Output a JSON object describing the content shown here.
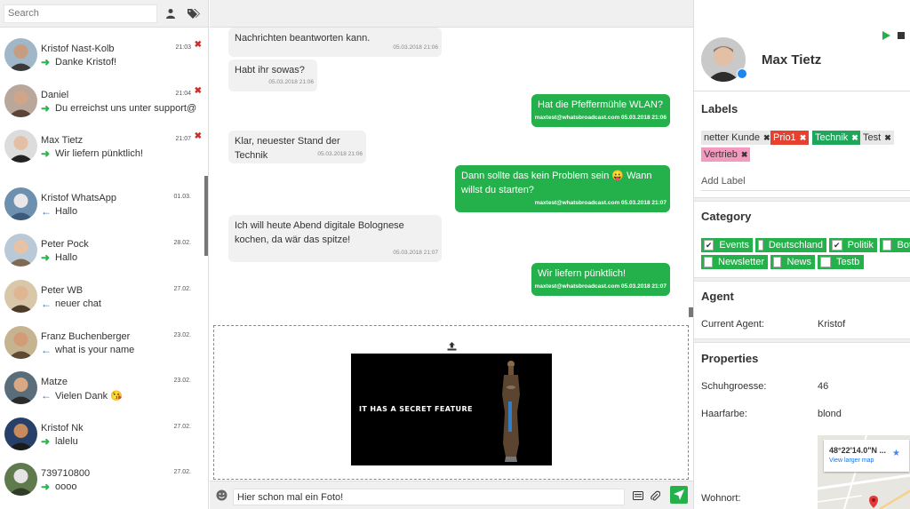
{
  "search": {
    "placeholder": "Search"
  },
  "contacts": [
    {
      "name": "Kristof Nast-Kolb",
      "time": "21:03",
      "last": "Danke Kristof!",
      "dir": "out",
      "closable": true
    },
    {
      "name": "Daniel",
      "time": "21:04",
      "last": "Du erreichst uns unter support@...",
      "dir": "out",
      "closable": true
    },
    {
      "name": "Max Tietz",
      "time": "21:07",
      "last": "Wir liefern pünktlich!",
      "dir": "out",
      "closable": true
    },
    {
      "name": "Kristof WhatsApp",
      "time": "01.03.",
      "last": "Hallo",
      "dir": "in",
      "closable": false
    },
    {
      "name": "Peter Pock",
      "time": "28.02.",
      "last": "Hallo",
      "dir": "out",
      "closable": false
    },
    {
      "name": "Peter WB",
      "time": "27.02.",
      "last": "neuer chat",
      "dir": "in",
      "closable": false
    },
    {
      "name": "Franz Buchenberger",
      "time": "23.02.",
      "last": "what is your name",
      "dir": "in",
      "closable": false
    },
    {
      "name": "Matze",
      "time": "23.02.",
      "last": "Vielen Dank 😘",
      "dir": "in",
      "closable": false
    },
    {
      "name": "Kristof Nk",
      "time": "27.02.",
      "last": "lalelu",
      "dir": "out",
      "closable": false
    },
    {
      "name": "739710800",
      "time": "27.02.",
      "last": "oooo",
      "dir": "out",
      "closable": false
    }
  ],
  "messages": [
    {
      "dir": "in",
      "text": "Nachrichten beantworten kann.",
      "meta": "05.03.2018 21:06"
    },
    {
      "dir": "in",
      "text": "Habt ihr sowas?",
      "meta": "05.03.2018 21:06"
    },
    {
      "dir": "out",
      "text": "Hat die Pfeffermühle WLAN?",
      "meta": "maxtest@whatsbroadcast.com 05.03.2018 21:06"
    },
    {
      "dir": "in",
      "text": "Klar, neuester Stand der Technik",
      "meta": "05.03.2018 21:06"
    },
    {
      "dir": "out",
      "text": "Dann sollte das kein Problem sein 😛 Wann willst du starten?",
      "meta": "maxtest@whatsbroadcast.com 05.03.2018 21:07"
    },
    {
      "dir": "in",
      "text": "Ich will heute Abend digitale Bolognese kochen, da wär das spitze!",
      "meta": "05.03.2018 21:07"
    },
    {
      "dir": "out",
      "text": "Wir liefern pünktlich!",
      "meta": "maxtest@whatsbroadcast.com 05.03.2018 21:07"
    }
  ],
  "upload": {
    "preview_text": "IT HAS A SECRET FEATURE"
  },
  "composer": {
    "value": "Hier schon mal ein Foto!"
  },
  "profile": {
    "name": "Max Tietz"
  },
  "labels": {
    "title": "Labels",
    "items": [
      {
        "text": "netter Kunde",
        "bg": "#e8e8e8",
        "fg": "#333333"
      },
      {
        "text": "Prio1",
        "bg": "#e8402e",
        "fg": "#ffffff"
      },
      {
        "text": "Technik",
        "bg": "#1ea65a",
        "fg": "#ffffff"
      },
      {
        "text": "Test",
        "bg": "#e8e8e8",
        "fg": "#333333"
      },
      {
        "text": "Vertrieb",
        "bg": "#f49ac0",
        "fg": "#333333"
      }
    ],
    "add_label": "Add Label"
  },
  "category": {
    "title": "Category",
    "items": [
      {
        "text": "Events",
        "checked": true
      },
      {
        "text": "Deutschland",
        "checked": false
      },
      {
        "text": "Politik",
        "checked": true
      },
      {
        "text": "Bot",
        "checked": false
      },
      {
        "text": "Newsletter",
        "checked": false
      },
      {
        "text": "News",
        "checked": false
      },
      {
        "text": "Testb",
        "checked": false
      }
    ]
  },
  "agent": {
    "title": "Agent",
    "label": "Current Agent:",
    "value": "Kristof"
  },
  "properties": {
    "title": "Properties",
    "items": [
      {
        "label": "Schuhgroesse:",
        "value": "46"
      },
      {
        "label": "Haarfarbe:",
        "value": "blond"
      },
      {
        "label": "Wohnort:",
        "value": ""
      }
    ],
    "map_coords": "48°22'14.0\"N ...",
    "map_link": "View larger map"
  },
  "colors": {
    "accent": "#24b14b",
    "close": "#c9302c",
    "incoming": "#2a76c8"
  }
}
